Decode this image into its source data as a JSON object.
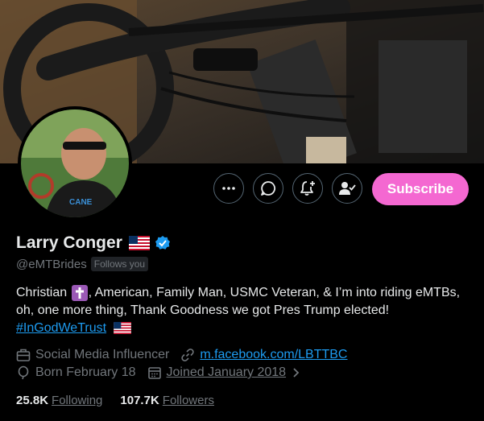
{
  "profile": {
    "name": "Larry Conger",
    "handle": "@eMTBrides",
    "follows_you": "Follows you",
    "bio": {
      "text1": "Christian",
      "text2": ", American, Family Man, USMC Veteran, & I’m into riding eMTBs, oh, one more thing, Thank Goodness we got Pres Trump elected! ",
      "hashtag": "#InGodWeTrust"
    },
    "category": "Social Media Influencer",
    "website": "m.facebook.com/LBTTBC",
    "birthday": "Born February 18",
    "joined": "Joined January 2018",
    "following_count": "25.8K",
    "following_label": "Following",
    "followers_count": "107.7K",
    "followers_label": "Followers"
  },
  "actions": {
    "subscribe_label": "Subscribe",
    "more_icon": "more-icon",
    "message_icon": "message-icon",
    "notify_icon": "bell-plus-icon",
    "following_icon": "person-check-icon"
  },
  "colors": {
    "accent": "#f468d1",
    "link": "#1d9bf0",
    "verified": "#1d9bf0",
    "background": "#000000"
  }
}
